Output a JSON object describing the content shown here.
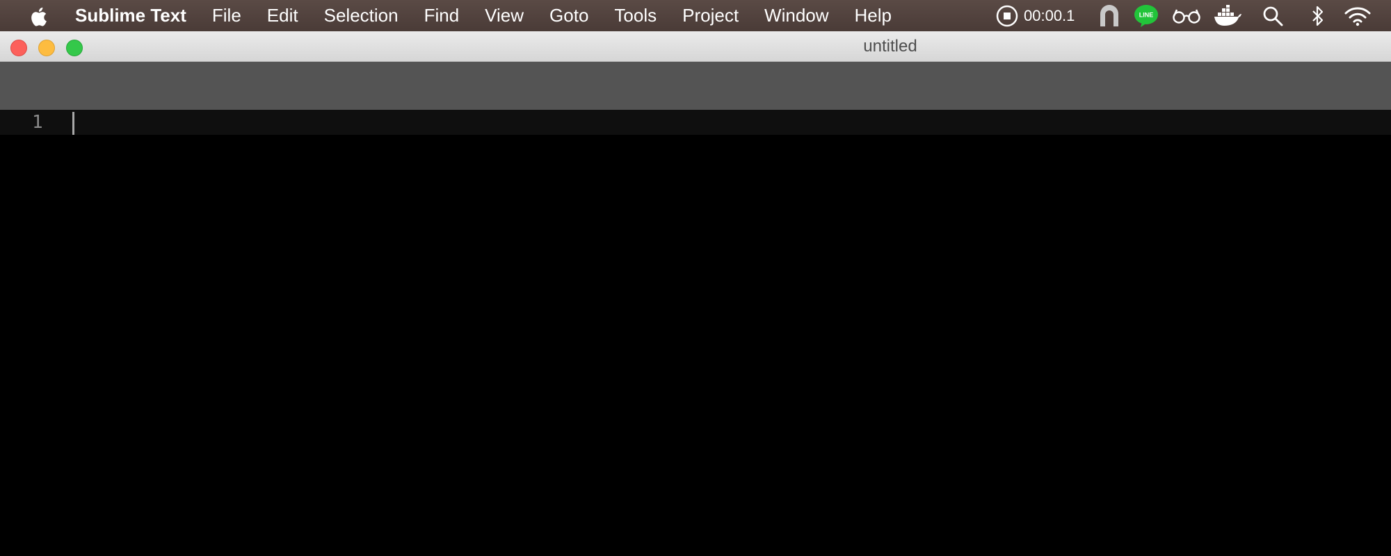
{
  "menubar": {
    "app_name": "Sublime Text",
    "items": [
      "File",
      "Edit",
      "Selection",
      "Find",
      "View",
      "Goto",
      "Tools",
      "Project",
      "Window",
      "Help"
    ],
    "status": {
      "recording_time": "00:00.1",
      "line_badge": "LINE",
      "icons": [
        "record-stop-icon",
        "vpn-icon",
        "line-app-icon",
        "glasses-icon",
        "docker-icon",
        "search-icon",
        "bluetooth-icon",
        "wifi-icon"
      ]
    }
  },
  "window": {
    "title": "untitled",
    "traffic_lights": {
      "close_color": "#fc605b",
      "minimize_color": "#fdbc40",
      "zoom_color": "#34c84a"
    }
  },
  "editor": {
    "line_numbers": [
      "1"
    ],
    "content": "",
    "background": "#000000"
  }
}
